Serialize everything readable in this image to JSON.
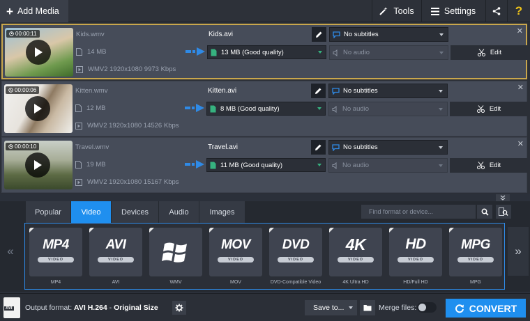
{
  "toolbar": {
    "add_media": "Add Media",
    "tools": "Tools",
    "settings": "Settings",
    "help": "?"
  },
  "items": [
    {
      "duration": "00:00:11",
      "src_name": "Kids.wmv",
      "src_size": "14 MB",
      "src_info": "WMV2 1920x1080 9973 Kbps",
      "out_name": "Kids.avi",
      "out_size": "13 MB (Good quality)",
      "subtitles": "No subtitles",
      "audio": "No audio",
      "edit": "Edit"
    },
    {
      "duration": "00:00:06",
      "src_name": "Kitten.wmv",
      "src_size": "12 MB",
      "src_info": "WMV2 1920x1080 14526 Kbps",
      "out_name": "Kitten.avi",
      "out_size": "8 MB (Good quality)",
      "subtitles": "No subtitles",
      "audio": "No audio",
      "edit": "Edit"
    },
    {
      "duration": "00:00:10",
      "src_name": "Travel.wmv",
      "src_size": "19 MB",
      "src_info": "WMV2 1920x1080 15167 Kbps",
      "out_name": "Travel.avi",
      "out_size": "11 MB (Good quality)",
      "subtitles": "No subtitles",
      "audio": "No audio",
      "edit": "Edit"
    }
  ],
  "tabs": [
    "Popular",
    "Video",
    "Devices",
    "Audio",
    "Images"
  ],
  "search": {
    "placeholder": "Find format or device..."
  },
  "formats": [
    {
      "logo": "MP4",
      "sub": "VIDEO",
      "label": "MP4"
    },
    {
      "logo": "AVI",
      "sub": "VIDEO",
      "label": "AVI"
    },
    {
      "logo": "",
      "sub": "",
      "label": "WMV"
    },
    {
      "logo": "MOV",
      "sub": "VIDEO",
      "label": "MOV"
    },
    {
      "logo": "DVD",
      "sub": "VIDEO",
      "label": "DVD-Compatible Video"
    },
    {
      "logo": "4K",
      "sub": "VIDEO",
      "label": "4K Ultra HD"
    },
    {
      "logo": "HD",
      "sub": "VIDEO",
      "label": "HD/Full HD"
    },
    {
      "logo": "MPG",
      "sub": "VIDEO",
      "label": "MPG"
    }
  ],
  "nav": {
    "prev": "«",
    "next": "»"
  },
  "bottom": {
    "file_icon": "AVI",
    "output_label": "Output format:",
    "output_format": "AVI H.264",
    "sep": " - ",
    "output_size": "Original Size",
    "save_to": "Save to...",
    "merge": "Merge files:",
    "convert": "CONVERT"
  },
  "colors": {
    "accent": "#1f8fef",
    "selected_border": "#c9a74c",
    "arrow": "#2f8ae6",
    "quality": "#36b27f"
  }
}
